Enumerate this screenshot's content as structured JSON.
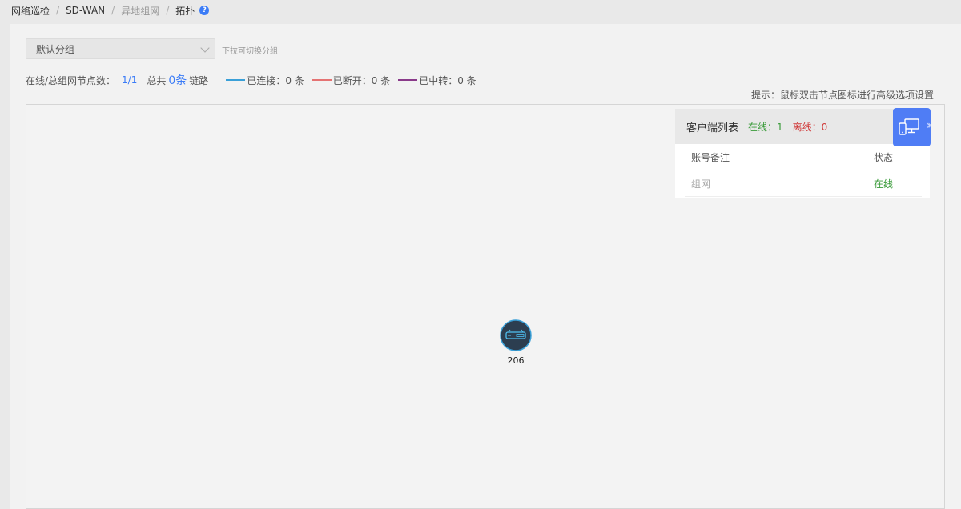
{
  "breadcrumb": {
    "items": [
      "网络巡检",
      "SD-WAN",
      "异地组网",
      "拓扑"
    ],
    "separator": "/",
    "help": "?"
  },
  "group": {
    "selected": "默认分组",
    "hint": "下拉可切换分组"
  },
  "stats": {
    "online_label": "在线/总组网节点数：",
    "online_value": "1/1",
    "total_prefix": "总共",
    "total_value": "0条",
    "total_suffix": "链路",
    "legend": [
      {
        "label": "已连接：0 条",
        "color": "#3aa0d8"
      },
      {
        "label": "已断开：0 条",
        "color": "#e57373"
      },
      {
        "label": "已中转：0 条",
        "color": "#8a3a8a"
      }
    ]
  },
  "tip": "提示：鼠标双击节点图标进行高级选项设置",
  "client_list": {
    "title": "客户端列表",
    "online": "在线：1",
    "offline": "离线：0",
    "columns": [
      "账号备注",
      "状态"
    ],
    "rows": [
      {
        "name": "组网",
        "status": "在线"
      }
    ]
  },
  "node": {
    "label": "206",
    "icon": "router-icon"
  },
  "colors": {
    "accent": "#3b7cf7",
    "online": "#3a9b3a",
    "offline": "#d03a3a",
    "toggle": "#4f7df5"
  }
}
